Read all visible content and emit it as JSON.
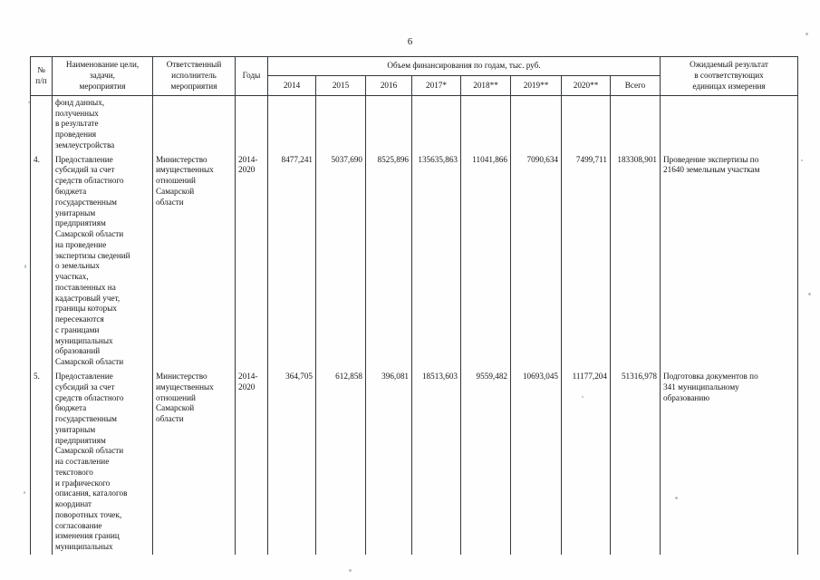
{
  "document": {
    "page_number": "6"
  },
  "table": {
    "header": {
      "col_index": [
        "№",
        "п/п"
      ],
      "col_name": [
        "Наименование цели,",
        "задачи,",
        "мероприятия"
      ],
      "col_executor": [
        "Ответственный",
        "исполнитель",
        "мероприятия"
      ],
      "col_years": "Годы",
      "col_financing_group": "Объем финансирования по годам, тыс. руб.",
      "col_financing_years": [
        "2014",
        "2015",
        "2016",
        "2017*",
        "2018**",
        "2019**",
        "2020**",
        "Всего"
      ],
      "col_result": [
        "Ожидаемый результат",
        "в соответствующих",
        "единицах измерения"
      ]
    },
    "rows": [
      {
        "index": "",
        "name_lines": [
          "фонд данных,",
          "полученных",
          "в результате",
          "проведения",
          "землеустройства"
        ],
        "executor_lines": [],
        "years": [],
        "values": [
          "",
          "",
          "",
          "",
          "",
          "",
          "",
          ""
        ],
        "result_lines": []
      },
      {
        "index": "4.",
        "name_lines": [
          "Предоставление",
          "субсидий за счет",
          "средств областного",
          "бюджета",
          "государственным",
          "унитарным",
          "предприятиям",
          "Самарской области",
          "на проведение",
          "экспертизы сведений",
          "о земельных",
          "участках,",
          "поставленных на",
          "кадастровый учет,",
          "границы которых",
          "пересекаются",
          "с границами",
          "муниципальных",
          "образований",
          "Самарской области"
        ],
        "executor_lines": [
          "Министерство",
          "имущественных",
          "отношений",
          "Самарской",
          "области"
        ],
        "years": [
          "2014-",
          "2020"
        ],
        "values": [
          "8477,241",
          "5037,690",
          "8525,896",
          "135635,863",
          "11041,866",
          "7090,634",
          "7499,711",
          "183308,901"
        ],
        "result_lines": [
          "Проведение экспертизы по",
          "21640 земельным участкам"
        ]
      },
      {
        "index": "5.",
        "name_lines": [
          "Предоставление",
          "субсидий за счет",
          "средств областного",
          "бюджета",
          "государственным",
          "унитарным",
          "предприятиям",
          "Самарской области",
          "на составление",
          "текстового",
          "и графического",
          "описания, каталогов",
          "координат",
          "поворотных точек,",
          "согласование",
          "изменения границ",
          "муниципальных"
        ],
        "executor_lines": [
          "Министерство",
          "имущественных",
          "отношений",
          "Самарской",
          "области"
        ],
        "years": [
          "2014-",
          "2020"
        ],
        "values": [
          "364,705",
          "612,858",
          "396,081",
          "18513,603",
          "9559,482",
          "10693,045",
          "11177,204",
          "51316,978"
        ],
        "result_lines": [
          "Подготовка документов по",
          "341 муниципальному",
          "образованию"
        ]
      }
    ]
  }
}
